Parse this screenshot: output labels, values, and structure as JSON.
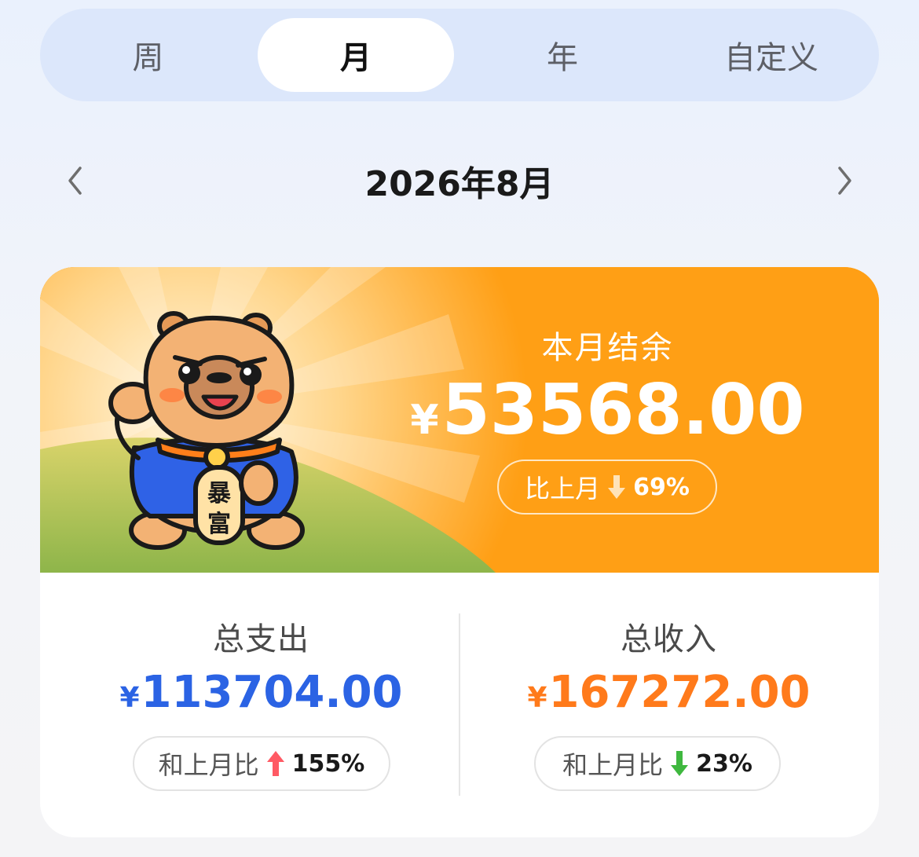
{
  "tabs": [
    {
      "label": "周"
    },
    {
      "label": "月"
    },
    {
      "label": "年"
    },
    {
      "label": "自定义"
    }
  ],
  "active_tab": "月",
  "period": {
    "label": "2026年8月",
    "prev_icon": "chevron-left-icon",
    "next_icon": "chevron-right-icon"
  },
  "balance": {
    "title": "本月结余",
    "currency": "¥",
    "amount": "53568.00",
    "compare_label": "比上月",
    "compare_direction": "down",
    "compare_pct": "69%"
  },
  "mascot": {
    "badge_text_1": "暴",
    "badge_text_2": "富"
  },
  "expense": {
    "label": "总支出",
    "currency": "¥",
    "amount": "113704.00",
    "compare_label": "和上月比",
    "compare_direction": "up",
    "compare_pct": "155%",
    "color": "#2b63e4"
  },
  "income": {
    "label": "总收入",
    "currency": "¥",
    "amount": "167272.00",
    "compare_label": "和上月比",
    "compare_direction": "down",
    "compare_pct": "23%",
    "color": "#ff7a1b"
  },
  "colors": {
    "banner": "#ff9f15",
    "arrow_up": "#ff5a64",
    "arrow_down": "#3fb83f"
  }
}
